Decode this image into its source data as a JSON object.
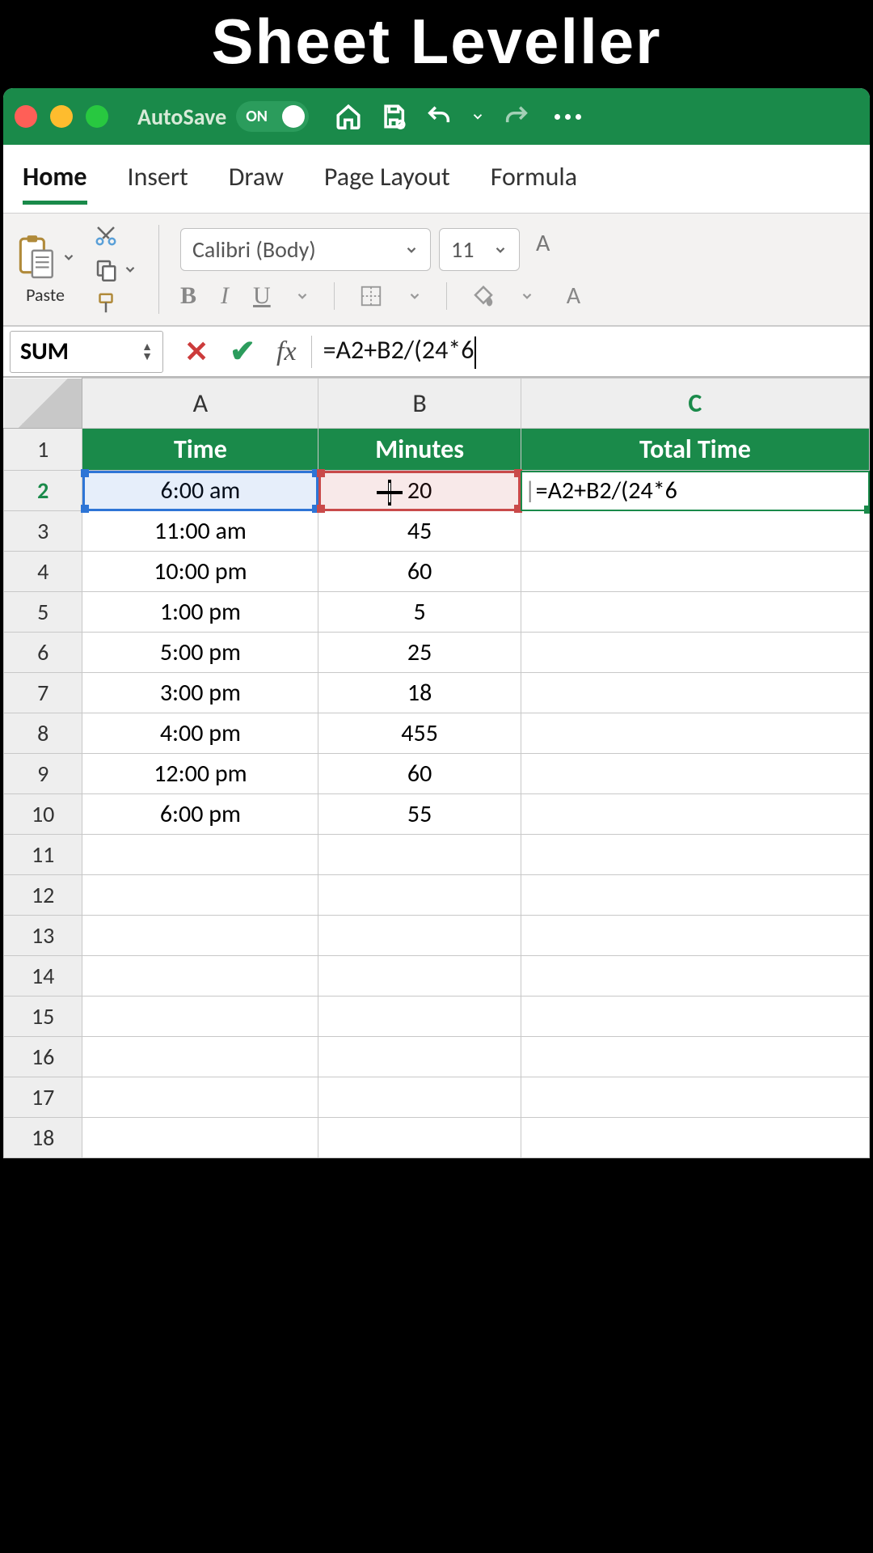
{
  "banner": {
    "title": "Sheet Leveller"
  },
  "titlebar": {
    "autosave_label": "AutoSave",
    "autosave_state": "ON"
  },
  "ribbon": {
    "tabs": [
      "Home",
      "Insert",
      "Draw",
      "Page Layout",
      "Formula"
    ],
    "active_tab": 0,
    "paste_label": "Paste",
    "font_name": "Calibri (Body)",
    "font_size": "11",
    "bold": "B",
    "italic": "I",
    "underline": "U",
    "fontA": "A"
  },
  "formula_bar": {
    "name_box": "SUM",
    "fx_label": "fx",
    "formula": "=A2+B2/(24*6"
  },
  "sheet": {
    "columns": [
      "A",
      "B",
      "C"
    ],
    "headers": {
      "A": "Time",
      "B": "Minutes",
      "C": "Total Time"
    },
    "rows": [
      {
        "n": 1
      },
      {
        "n": 2,
        "A": "6:00 am",
        "B": "20",
        "C": "=A2+B2/(24*6"
      },
      {
        "n": 3,
        "A": "11:00 am",
        "B": "45",
        "C": ""
      },
      {
        "n": 4,
        "A": "10:00 pm",
        "B": "60",
        "C": ""
      },
      {
        "n": 5,
        "A": "1:00 pm",
        "B": "5",
        "C": ""
      },
      {
        "n": 6,
        "A": "5:00 pm",
        "B": "25",
        "C": ""
      },
      {
        "n": 7,
        "A": "3:00 pm",
        "B": "18",
        "C": ""
      },
      {
        "n": 8,
        "A": "4:00 pm",
        "B": "455",
        "C": ""
      },
      {
        "n": 9,
        "A": "12:00 pm",
        "B": "60",
        "C": ""
      },
      {
        "n": 10,
        "A": "6:00 pm",
        "B": "55",
        "C": ""
      },
      {
        "n": 11
      },
      {
        "n": 12
      },
      {
        "n": 13
      },
      {
        "n": 14
      },
      {
        "n": 15
      },
      {
        "n": 16
      },
      {
        "n": 17
      },
      {
        "n": 18
      }
    ],
    "editing_cell_display": "20",
    "active_cell": "C2"
  }
}
